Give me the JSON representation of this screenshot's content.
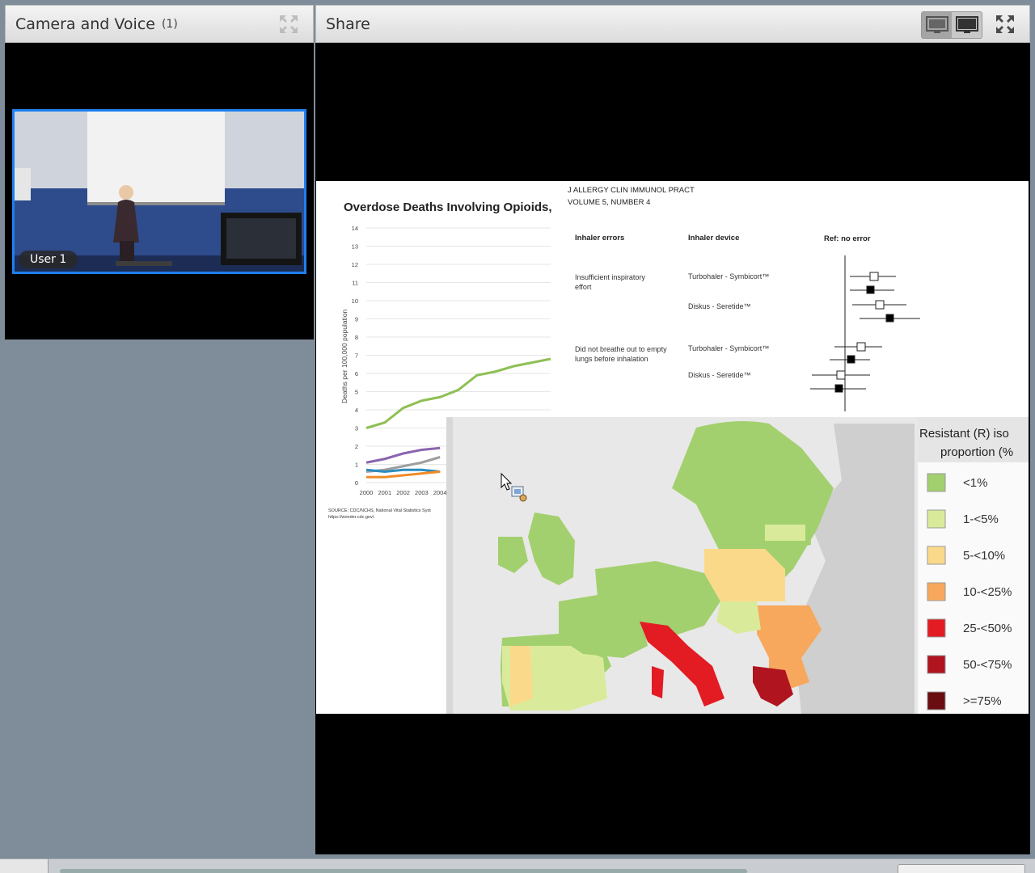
{
  "camera_pod": {
    "title": "Camera and Voice",
    "count": "(1)",
    "user_label": "User 1"
  },
  "share_pod": {
    "title": "Share"
  },
  "slide": {
    "chart1": {
      "title": "Overdose Deaths Involving Opioids,",
      "ylabel": "Deaths per 100,000 population",
      "yticks": [
        "0",
        "1",
        "2",
        "3",
        "4",
        "5",
        "6",
        "7",
        "8",
        "9",
        "10",
        "11",
        "12",
        "13",
        "14"
      ],
      "xticks": [
        "2000",
        "2001",
        "2002",
        "2003",
        "2004"
      ],
      "source_line1": "SOURCE: CDC/NCHS, National Vital Statistics Syst",
      "source_line2": "https://wonder.cdc.gov/."
    },
    "journal": {
      "line1": "J ALLERGY CLIN IMMUNOL PRACT",
      "line2": "VOLUME 5, NUMBER 4"
    },
    "forest": {
      "col_errors": "Inhaler errors",
      "col_device": "Inhaler device",
      "col_ref": "Ref: no error",
      "error1_line1": "Insufficient inspiratory",
      "error1_line2": "effort",
      "error2_line1": "Did not breathe out to empty",
      "error2_line2": "lungs before inhalation",
      "device_a": "Turbohaler - Symbicort™",
      "device_b": "Diskus - Seretide™",
      "device_c": "Turbohaler - Symbicort™",
      "device_d": "Diskus - Seretide™"
    },
    "map_legend": {
      "title_line1": "Resistant (R) iso",
      "title_line2": "proportion (%",
      "items": [
        "<1%",
        "1-<5%",
        "5-<10%",
        "10-<25%",
        "25-<50%",
        "50-<75%",
        ">=75%"
      ],
      "colors": [
        "#a3d06e",
        "#d9eb9a",
        "#fbd98b",
        "#f7a85c",
        "#e31b23",
        "#b0141e",
        "#6a0d10"
      ]
    }
  },
  "chart_data": {
    "type": "line",
    "title": "Overdose Deaths Involving Opioids,",
    "ylabel": "Deaths per 100,000 population",
    "x": [
      2000,
      2001,
      2002,
      2003,
      2004,
      2005,
      2006,
      2007,
      2008,
      2009,
      2010
    ],
    "ylim": [
      0,
      14
    ],
    "series": [
      {
        "color": "#8fbf55",
        "values": [
          3.0,
          3.3,
          4.1,
          4.5,
          4.7,
          5.1,
          5.9,
          6.1,
          6.4,
          6.6,
          6.8
        ]
      },
      {
        "color": "#8a64b0",
        "values": [
          1.1,
          1.3,
          1.6,
          1.8,
          1.9
        ]
      },
      {
        "color": "#9e9e9e",
        "values": [
          0.6,
          0.7,
          0.9,
          1.1,
          1.4
        ]
      },
      {
        "color": "#2b8cbf",
        "values": [
          0.7,
          0.6,
          0.7,
          0.7,
          0.6
        ]
      },
      {
        "color": "#f08c28",
        "values": [
          0.3,
          0.3,
          0.4,
          0.5,
          0.6
        ]
      }
    ]
  }
}
